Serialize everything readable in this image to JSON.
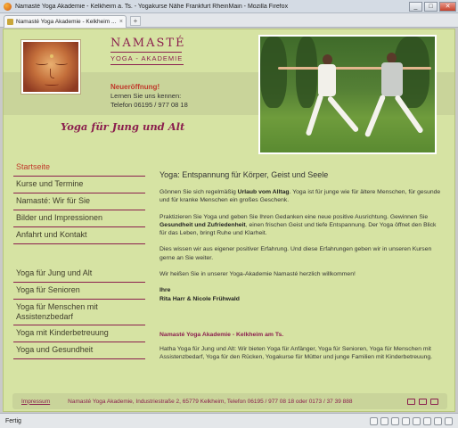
{
  "window": {
    "title": "Namasté Yoga Akademie - Kelkheim a. Ts. - Yogakurse Nähe Frankfurt RheinMain - Mozilla Firefox",
    "minimize": "_",
    "maximize": "□",
    "close": "✕"
  },
  "tab": {
    "label": "Namasté Yoga Akademie - Kelkheim ...",
    "close": "×",
    "new": "+"
  },
  "brand": {
    "name": "NAMASTÉ",
    "sub": "YOGA - AKADEMIE"
  },
  "news": {
    "heading": "Neueröffnung!",
    "line1": "Lernen Sie uns kennen:",
    "line2": "Telefon 06195 / 977 08 18"
  },
  "slogan": "Yoga für Jung und Alt",
  "nav": {
    "items": [
      {
        "label": "Startseite"
      },
      {
        "label": "Kurse und Termine"
      },
      {
        "label": "Namasté: Wir für Sie"
      },
      {
        "label": "Bilder und Impressionen"
      },
      {
        "label": "Anfahrt und Kontakt"
      },
      {
        "label": "Yoga für Jung und Alt"
      },
      {
        "label": "Yoga für Senioren"
      },
      {
        "label": "Yoga für Menschen mit Assistenzbedarf"
      },
      {
        "label": "Yoga mit Kinderbetreuung"
      },
      {
        "label": "Yoga und Gesundheit"
      }
    ]
  },
  "content": {
    "heading": "Yoga: Entspannung für Körper, Geist und Seele",
    "p1a": "Gönnen Sie sich regelmäßig ",
    "p1b": "Urlaub vom Alltag",
    "p1c": ". Yoga ist für junge wie für ältere Menschen, für gesunde und für kranke Menschen ein großes Geschenk.",
    "p2a": "Praktizieren Sie Yoga und geben Sie Ihren Gedanken eine neue positive Ausrichtung. Gewinnen Sie ",
    "p2b": "Gesundheit und Zufriedenheit",
    "p2c": ", einen frischen Geist und tiefe Entspannung. Der Yoga öffnet den Blick für das Leben, bringt Ruhe und Klarheit.",
    "p3": "Dies wissen wir aus eigener positiver Erfahrung. Und diese Erfahrungen geben wir in unseren Kursen gerne an Sie weiter.",
    "p4": "Wir heißen Sie in unserer Yoga-Akademie Namasté herzlich willkommen!",
    "sign1": "Ihre",
    "sign2": "Rita Harr & Nicole Frühwald",
    "seo_title": "Namasté Yoga Akademie - Kelkheim am Ts.",
    "seo_text": "Hatha Yoga für Jung und Alt: Wir bieten Yoga für Anfänger, Yoga für Senioren, Yoga für Menschen mit Assistenzbedarf, Yoga für den Rücken, Yogakurse für Mütter und junge Familien mit Kinderbetreuung."
  },
  "footer": {
    "impressum": "Impressum",
    "address": "Namasté Yoga Akademie, Industriestraße 2, 65779 Kelkheim, Telefon 06195 / 977 08 18 oder 0173 / 37 39 888"
  },
  "status": {
    "text": "Fertig"
  },
  "colors": {
    "page_bg": "#d6e3a3",
    "accent": "#8b1f4e",
    "news_red": "#c0392b"
  }
}
